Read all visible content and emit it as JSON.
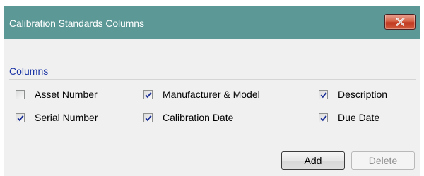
{
  "window": {
    "title": "Calibration Standards Columns"
  },
  "group": {
    "label": "Columns"
  },
  "columns": [
    {
      "label": "Asset Number",
      "checked": false
    },
    {
      "label": "Manufacturer & Model",
      "checked": true
    },
    {
      "label": "Description",
      "checked": true
    },
    {
      "label": "Serial Number",
      "checked": true
    },
    {
      "label": "Calibration Date",
      "checked": true
    },
    {
      "label": "Due Date",
      "checked": true
    }
  ],
  "buttons": {
    "add_label": "Add",
    "delete_label": "Delete"
  },
  "icons": {
    "close": "close-icon",
    "check": "checkmark-icon"
  },
  "colors": {
    "titlebar": "#5b9896",
    "group_label": "#1c35a6",
    "close_button": "#c0391f",
    "checkmark": "#1b2f96"
  }
}
